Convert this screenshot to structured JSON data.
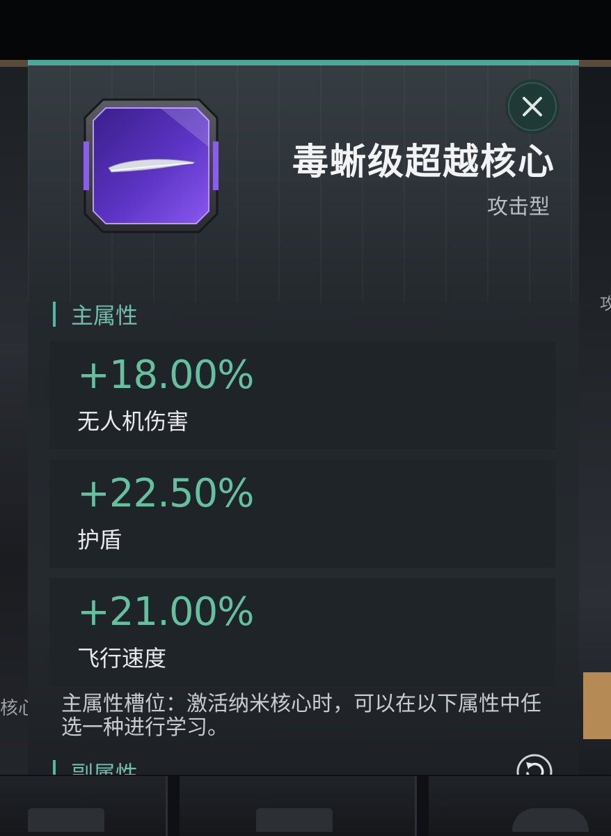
{
  "item": {
    "name": "毒蜥级超越核心",
    "type": "攻击型",
    "icon": "violet-drone-core-icon"
  },
  "sections": {
    "main_title": "主属性",
    "sub_title": "副属性"
  },
  "main_stats": [
    {
      "value": "+18.00%",
      "label": "无人机伤害"
    },
    {
      "value": "+22.50%",
      "label": "护盾"
    },
    {
      "value": "+21.00%",
      "label": "飞行速度"
    }
  ],
  "description": "主属性槽位：激活纳米核心时，可以在以下属性中任选一种进行学习。",
  "background": {
    "left_label": "核心",
    "right_label": "攻"
  },
  "colors": {
    "accent": "#4fb9a5",
    "stat_value": "#63c19f",
    "panel": "#262b30",
    "core_purple": "#6a3fd0"
  }
}
